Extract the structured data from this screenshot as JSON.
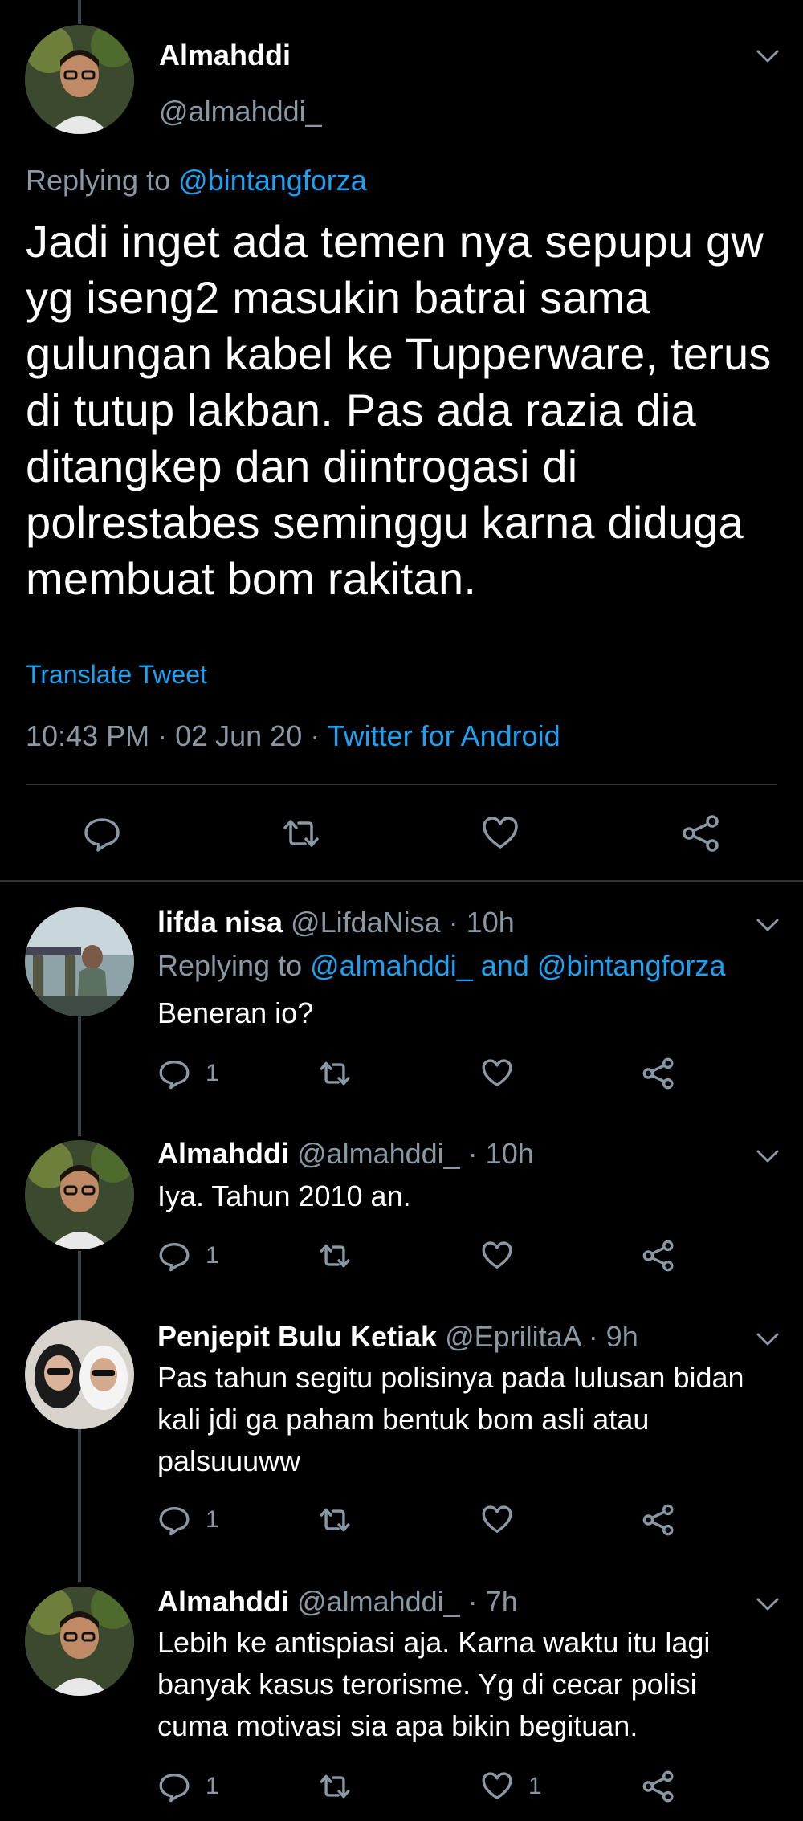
{
  "main_tweet": {
    "display_name": "Almahddi",
    "handle": "@almahddi_",
    "replying_prefix": "Replying to ",
    "replying_to": "@bintangforza",
    "text": "Jadi inget ada temen nya sepupu gw yg iseng2 masukin batrai sama gulungan kabel ke Tupperware, terus di tutup lakban. Pas ada razia dia ditangkep dan diintrogasi di polrestabes seminggu karna diduga membuat bom rakitan.",
    "translate_label": "Translate Tweet",
    "timestamp": "10:43 PM · 02 Jun 20 · ",
    "source": "Twitter for Android",
    "actions": [
      "comment-icon",
      "retweet-icon",
      "like-icon",
      "share-icon"
    ]
  },
  "replies": [
    {
      "display_name": "lifda nisa",
      "meta": " @LifdaNisa · 10h",
      "replying_prefix": "Replying to ",
      "replying_to": "@almahddi_ and @bintangforza",
      "text": "Beneran io?",
      "reply_count": "1",
      "like_count": ""
    },
    {
      "display_name": "Almahddi",
      "meta": " @almahddi_ · 10h",
      "text": "Iya. Tahun 2010 an.",
      "reply_count": "1",
      "like_count": ""
    },
    {
      "display_name": "Penjepit Bulu Ketiak",
      "meta": " @EprilitaA · 9h",
      "text": "Pas tahun segitu polisinya pada lulusan bidan kali jdi ga paham bentuk bom asli atau palsuuuww",
      "reply_count": "1",
      "like_count": ""
    },
    {
      "display_name": "Almahddi",
      "meta": " @almahddi_ · 7h",
      "text": "Lebih ke antispiasi aja. Karna waktu itu lagi banyak kasus terorisme. Yg di cecar polisi cuma motivasi sia apa bikin begituan.",
      "reply_count": "1",
      "like_count": "1"
    }
  ],
  "colors": {
    "background": "#000000",
    "text": "#ffffff",
    "secondary": "#8899a6",
    "accent": "#1da1f2",
    "divider": "#2f3336"
  }
}
